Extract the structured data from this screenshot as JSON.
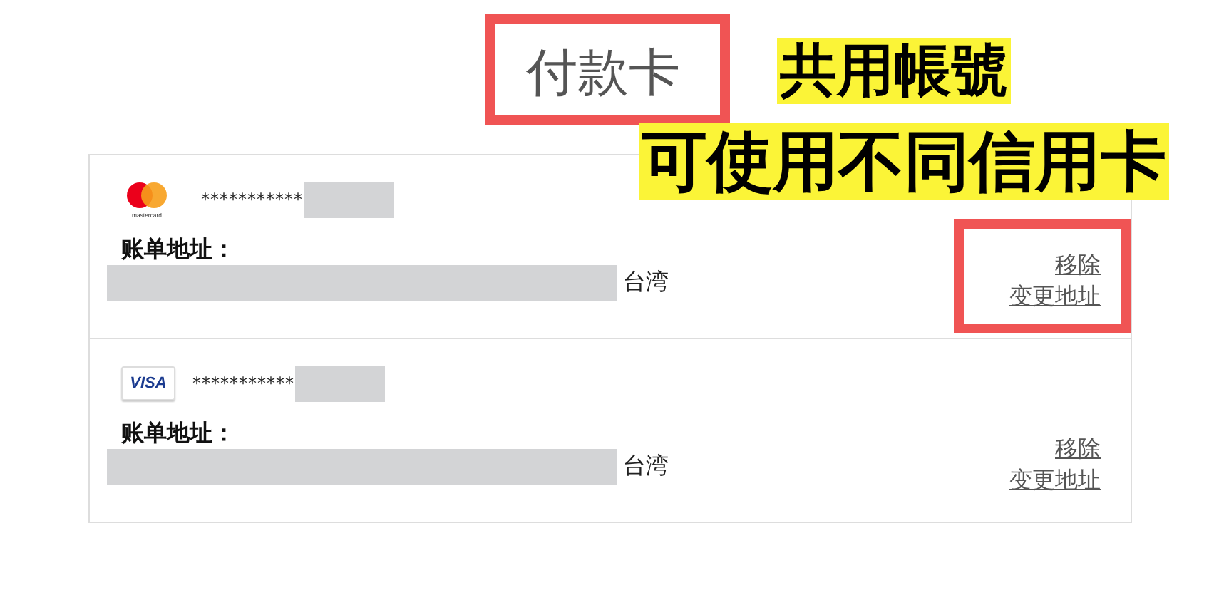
{
  "title": {
    "text": "付款卡",
    "highlighted": true
  },
  "annotations": [
    "共用帳號",
    "可使用不同信用卡"
  ],
  "cards": [
    {
      "kind": "mastercard",
      "logo_text": "mastercard",
      "number": "***********",
      "billing_label": "账单地址：",
      "country": "台湾",
      "actions": [
        "移除",
        "变更地址"
      ],
      "highlighted": true
    },
    {
      "kind": "visa",
      "logo_text": "VISA",
      "number": "***********",
      "billing_label": "账单地址：",
      "country": "台湾",
      "actions": [
        "移除",
        "变更地址"
      ],
      "highlighted": false
    }
  ]
}
